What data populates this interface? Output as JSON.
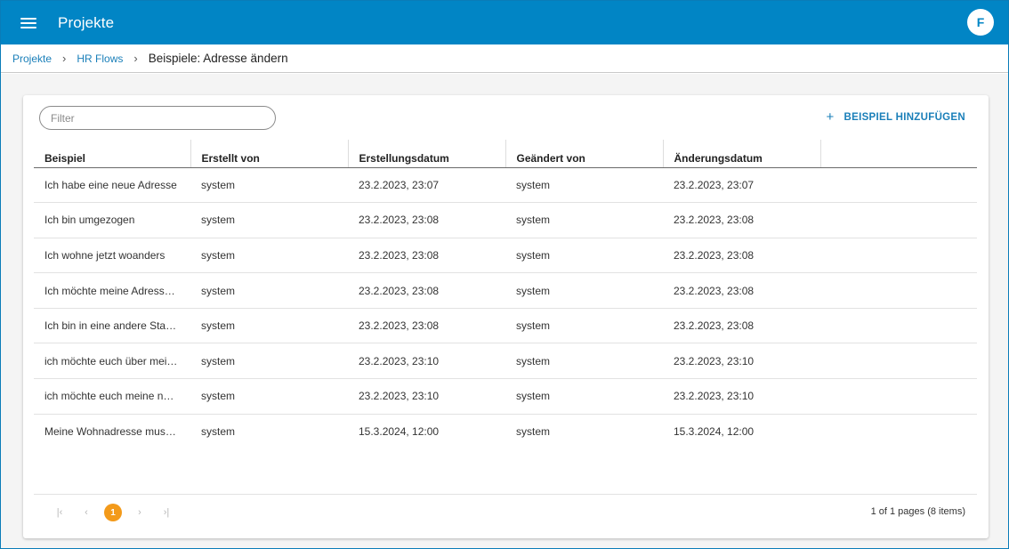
{
  "header": {
    "title": "Projekte",
    "avatar_initial": "F"
  },
  "breadcrumb": {
    "items": [
      "Projekte",
      "HR Flows"
    ],
    "current": "Beispiele: Adresse ändern",
    "separator": "›"
  },
  "toolbar": {
    "filter_placeholder": "Filter",
    "add_label": "BEISPIEL HINZUFÜGEN",
    "add_icon": "+"
  },
  "table": {
    "columns": [
      "Beispiel",
      "Erstellt von",
      "Erstellungsdatum",
      "Geändert von",
      "Änderungsdatum",
      ""
    ],
    "rows": [
      [
        "Ich habe eine neue Adresse",
        "system",
        "23.2.2023, 23:07",
        "system",
        "23.2.2023, 23:07"
      ],
      [
        "Ich bin umgezogen",
        "system",
        "23.2.2023, 23:08",
        "system",
        "23.2.2023, 23:08"
      ],
      [
        "Ich wohne jetzt woanders",
        "system",
        "23.2.2023, 23:08",
        "system",
        "23.2.2023, 23:08"
      ],
      [
        "Ich möchte meine Adresse ä...",
        "system",
        "23.2.2023, 23:08",
        "system",
        "23.2.2023, 23:08"
      ],
      [
        "Ich bin in eine andere Stadt ...",
        "system",
        "23.2.2023, 23:08",
        "system",
        "23.2.2023, 23:08"
      ],
      [
        "ich möchte euch über meine...",
        "system",
        "23.2.2023, 23:10",
        "system",
        "23.2.2023, 23:10"
      ],
      [
        "ich möchte euch meine neue...",
        "system",
        "23.2.2023, 23:10",
        "system",
        "23.2.2023, 23:10"
      ],
      [
        "Meine Wohnadresse muss g...",
        "system",
        "15.3.2024, 12:00",
        "system",
        "15.3.2024, 12:00"
      ]
    ]
  },
  "pager": {
    "first": "|‹",
    "prev": "‹",
    "current": "1",
    "next": "›",
    "last": "›|",
    "info": "1 of 1 pages (8 items)"
  },
  "colors": {
    "primary": "#0185c5",
    "accent": "#f39a1a",
    "link": "#1a7fb9"
  }
}
